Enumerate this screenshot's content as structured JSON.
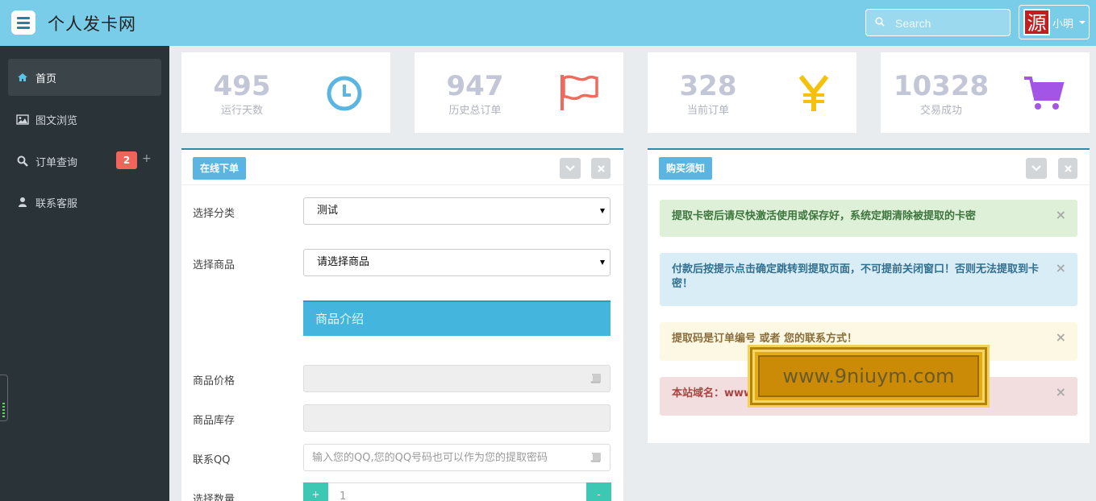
{
  "header": {
    "brand": "个人发卡网",
    "search_placeholder": "Search",
    "avatar_text": "源",
    "user_name": "小明"
  },
  "sidebar": {
    "items": [
      {
        "label": "首页",
        "icon": "home-icon"
      },
      {
        "label": "图文浏览",
        "icon": "image-icon"
      },
      {
        "label": "订单查询",
        "icon": "search-icon",
        "badge": "2",
        "extra": "+"
      },
      {
        "label": "联系客服",
        "icon": "user-icon"
      }
    ]
  },
  "stats": [
    {
      "value": "495",
      "label": "运行天数",
      "icon": "clock-icon",
      "color": "#5bb5e2"
    },
    {
      "value": "947",
      "label": "历史总订单",
      "icon": "flag-icon",
      "color": "#ee6b5e"
    },
    {
      "value": "328",
      "label": "当前订单",
      "icon": "yen-icon",
      "color": "#f4c20d"
    },
    {
      "value": "10328",
      "label": "交易成功",
      "icon": "cart-icon",
      "color": "#a356e6"
    }
  ],
  "order_panel": {
    "title": "在线下单",
    "category_label": "选择分类",
    "category_value": "测试",
    "product_label": "选择商品",
    "product_value": "请选择商品",
    "intro_title": "商品介绍",
    "price_label": "商品价格",
    "stock_label": "商品库存",
    "qq_label": "联系QQ",
    "qq_placeholder": "输入您的QQ,您的QQ号码也可以作为您的提取密码",
    "qty_label": "选择数量",
    "qty_plus": "+",
    "qty_value": "1",
    "qty_minus": "-"
  },
  "notice_panel": {
    "title": "购买须知",
    "alerts": [
      {
        "text": "提取卡密后请尽快激活使用或保存好，系统定期清除被提取的卡密",
        "close": "×"
      },
      {
        "text": "付款后按提示点击确定跳转到提取页面，不可提前关闭窗口！否则无法提取到卡密！",
        "close": "×"
      },
      {
        "text": "提取码是订单编号 或者 您的联系方式！",
        "close": "×"
      },
      {
        "text": "本站域名：www",
        "close": "×"
      }
    ]
  },
  "watermark": {
    "text": "www.9niuym.com"
  },
  "colors": {
    "header_bg": "#79cde8",
    "sidebar_bg": "#2a3338",
    "accent": "#5bb5e2",
    "teal": "#3cc8b3"
  }
}
